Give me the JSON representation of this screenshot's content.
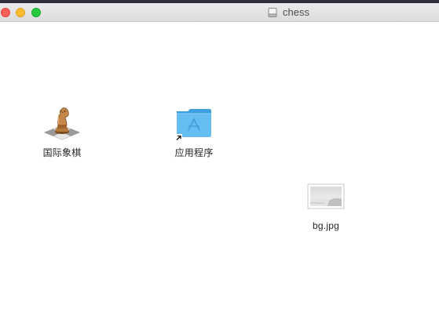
{
  "window": {
    "title": "chess"
  },
  "finder_items": [
    {
      "label": "国际象棋",
      "icon": "chess-knight-app-icon"
    },
    {
      "label": "应用程序",
      "icon": "applications-folder-alias-icon"
    },
    {
      "label": "bg.jpg",
      "icon": "jpg-image-thumbnail"
    }
  ],
  "colors": {
    "close": "#fe5f57",
    "minimize": "#febc2e",
    "maximize": "#28c840",
    "folder": "#5fb8ef"
  }
}
